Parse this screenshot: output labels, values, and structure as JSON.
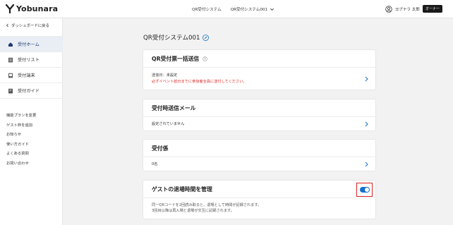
{
  "header": {
    "logo_text": "Yobunara",
    "nav_system": "QR受付システム",
    "nav_event": "QR受付システム001",
    "user_name": "ヨブナラ 太郎",
    "owner_badge": "オーナー"
  },
  "sidebar": {
    "back_label": "ダッシュボードに戻る",
    "items": [
      {
        "label": "受付ホーム",
        "icon": "home-icon",
        "active": true
      },
      {
        "label": "受付リスト",
        "icon": "list-icon",
        "active": false
      },
      {
        "label": "受付端末",
        "icon": "terminal-icon",
        "active": false
      },
      {
        "label": "受付ガイド",
        "icon": "guide-icon",
        "active": false
      }
    ],
    "links": [
      "機能プランを変更",
      "ゲスト枠を追加",
      "お知らせ",
      "使い方ガイド",
      "よくある質問",
      "お問い合わせ"
    ]
  },
  "main": {
    "title": "QR受付システム001",
    "cards": [
      {
        "title": "QR受付票一括送信",
        "line1": "送信日：未設定",
        "line2": "必ずイベント前日までに参加者全員に送付してください。"
      },
      {
        "title": "受付時送信メール",
        "line1": "設定されていません"
      },
      {
        "title": "受付係",
        "line1": "0名"
      },
      {
        "title": "ゲストの退場時間を管理",
        "line1": "同一QRコードを2回読み取ると、退場として時間が記録されます。",
        "line2": "3回目以降は再入場と退場が交互に記録されます。",
        "toggle_on": true
      }
    ]
  },
  "colors": {
    "accent": "#1570c9",
    "warning": "#e02d2d",
    "active_bg": "#e9eef5",
    "highlight_border": "#e02020"
  }
}
